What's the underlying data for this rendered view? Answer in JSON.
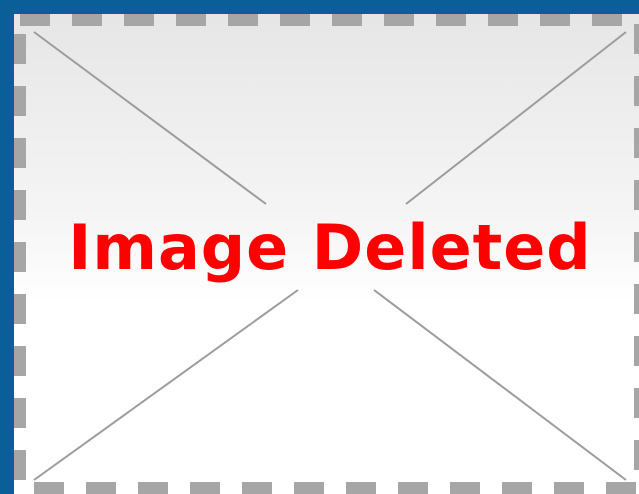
{
  "placeholder": {
    "message": "Image Deleted",
    "text_color": "#ff0000",
    "border_color": "#0b5f99",
    "dash_color": "#a6a6a6",
    "cross_color": "#9c9c9c",
    "icon": "image-deleted-placeholder"
  }
}
